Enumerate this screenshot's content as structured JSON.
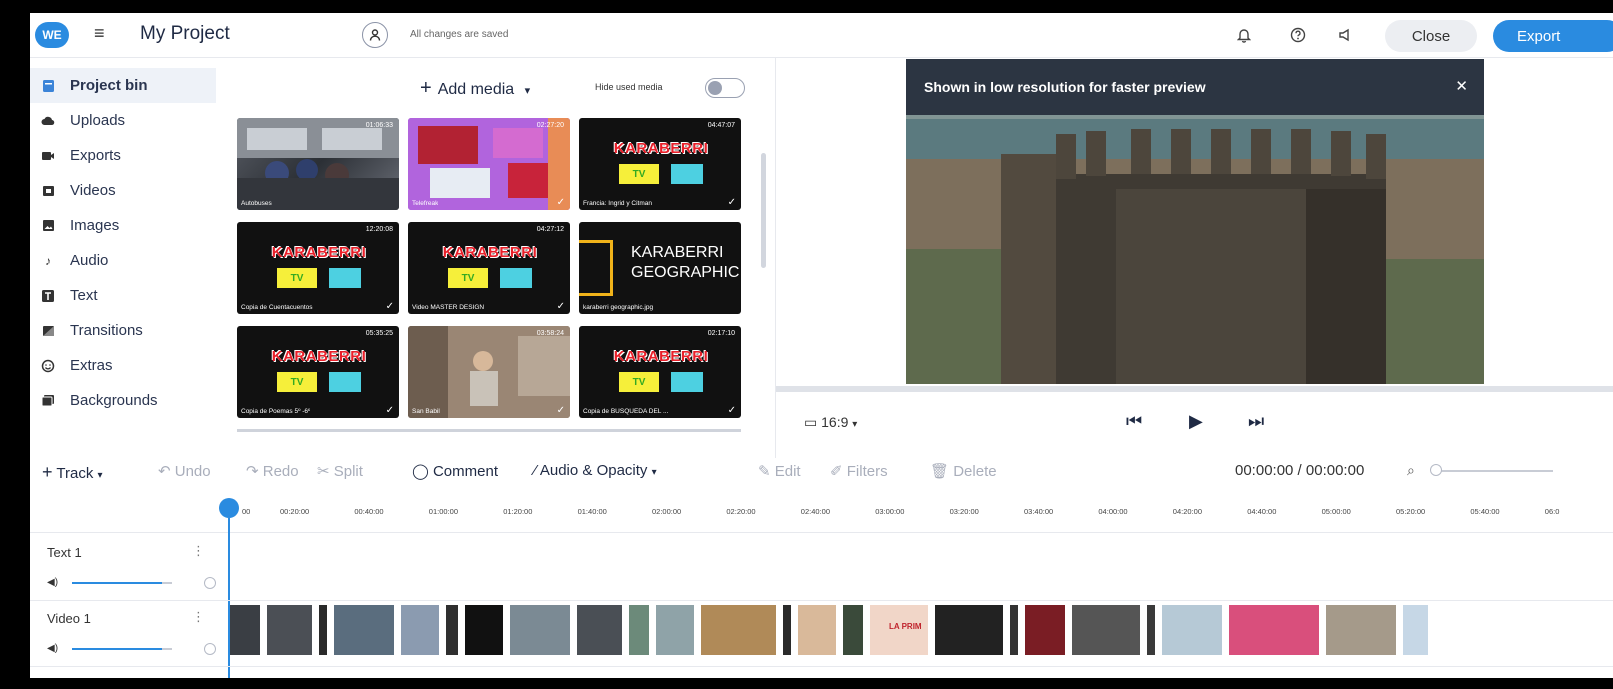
{
  "header": {
    "logo_text": "WE",
    "project_title": "My Project",
    "save_status": "All changes are saved",
    "close_label": "Close",
    "export_label": "Export"
  },
  "sidebar": {
    "items": [
      {
        "label": "Project bin",
        "icon": "bin-icon"
      },
      {
        "label": "Uploads",
        "icon": "cloud-upload-icon"
      },
      {
        "label": "Exports",
        "icon": "export-icon"
      },
      {
        "label": "Videos",
        "icon": "video-icon"
      },
      {
        "label": "Images",
        "icon": "image-icon"
      },
      {
        "label": "Audio",
        "icon": "music-note-icon"
      },
      {
        "label": "Text",
        "icon": "text-icon"
      },
      {
        "label": "Transitions",
        "icon": "transition-icon"
      },
      {
        "label": "Extras",
        "icon": "sticker-icon"
      },
      {
        "label": "Backgrounds",
        "icon": "background-icon"
      }
    ]
  },
  "media": {
    "add_label": "Add media",
    "hide_used_label": "Hide used media",
    "items": [
      {
        "duration": "01:06:33",
        "name": "Autobuses"
      },
      {
        "duration": "02:27:20",
        "name": "Telefreak"
      },
      {
        "duration": "04:47:07",
        "name": "Francia: Ingrid y Citman"
      },
      {
        "duration": "12:20:08",
        "name": "Copia de Cuentacuentos"
      },
      {
        "duration": "04:27:12",
        "name": "Video MASTER DESIGN"
      },
      {
        "duration": "",
        "name": "karaberri geographic.jpg"
      },
      {
        "duration": "05:35:25",
        "name": "Copia de Poemas 5º -6º"
      },
      {
        "duration": "03:58:24",
        "name": "San Babil"
      },
      {
        "duration": "02:17:10",
        "name": "Copia de BÚSQUEDA DEL ..."
      }
    ],
    "karaberri_logo": "KARABERRI",
    "karaberri_tv": "TV",
    "geographic_line1": "KARABERRI",
    "geographic_line2": "GEOGRAPHIC"
  },
  "preview": {
    "banner": "Shown in low resolution for faster preview",
    "aspect_ratio": "16:9"
  },
  "timeline": {
    "track_label": "Track",
    "undo_label": "Undo",
    "redo_label": "Redo",
    "split_label": "Split",
    "comment_label": "Comment",
    "audio_opacity_label": "Audio & Opacity",
    "edit_label": "Edit",
    "filters_label": "Filters",
    "delete_label": "Delete",
    "timecode": "00:00:00 / 00:00:00",
    "ruler_ticks": [
      "00",
      "00:20:00",
      "00:40:00",
      "01:00:00",
      "01:20:00",
      "01:40:00",
      "02:00:00",
      "02:20:00",
      "02:40:00",
      "03:00:00",
      "03:20:00",
      "03:40:00",
      "04:00:00",
      "04:20:00",
      "04:40:00",
      "05:00:00",
      "05:20:00",
      "05:40:00",
      "06:0"
    ],
    "tracks": [
      {
        "name": "Text 1",
        "volume": 0.9
      },
      {
        "name": "Video 1",
        "volume": 0.9
      }
    ],
    "clip_text_la_prim": "LA PRIM"
  }
}
